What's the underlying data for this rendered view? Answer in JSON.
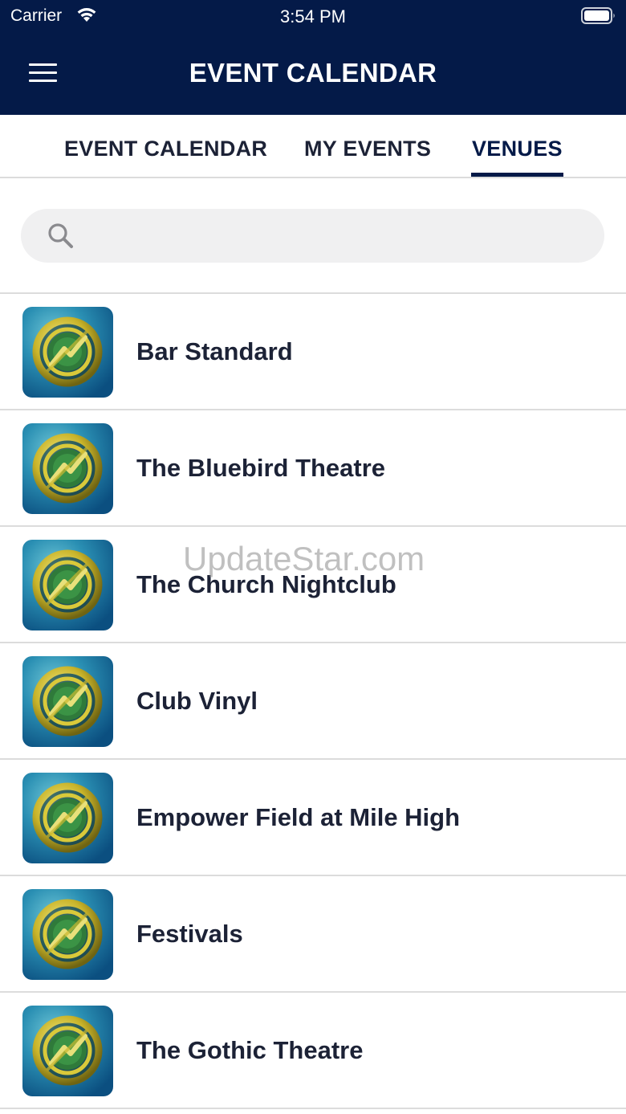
{
  "status_bar": {
    "carrier": "Carrier",
    "time": "3:54 PM",
    "wifi_icon": "wifi-icon",
    "battery_icon": "battery-icon"
  },
  "nav": {
    "title": "EVENT CALENDAR",
    "menu_icon": "hamburger-menu-icon",
    "background": "#041a48"
  },
  "tabs": [
    {
      "label": "EVENT CALENDAR",
      "active": false
    },
    {
      "label": "MY EVENTS",
      "active": false
    },
    {
      "label": "VENUES",
      "active": true
    }
  ],
  "search": {
    "placeholder": "",
    "value": "",
    "icon": "search-icon"
  },
  "venues": [
    {
      "name": "Bar Standard",
      "icon": "venue-logo-icon"
    },
    {
      "name": "The Bluebird Theatre",
      "icon": "venue-logo-icon"
    },
    {
      "name": "The Church Nightclub",
      "icon": "venue-logo-icon"
    },
    {
      "name": "Club Vinyl",
      "icon": "venue-logo-icon"
    },
    {
      "name": "Empower Field at Mile High",
      "icon": "venue-logo-icon"
    },
    {
      "name": "Festivals",
      "icon": "venue-logo-icon"
    },
    {
      "name": "The Gothic Theatre",
      "icon": "venue-logo-icon"
    }
  ],
  "watermark": "UpdateStar.com",
  "colors": {
    "accent": "#041a48",
    "divider": "#dcdcdc",
    "search_bg": "#f0f0f1"
  }
}
